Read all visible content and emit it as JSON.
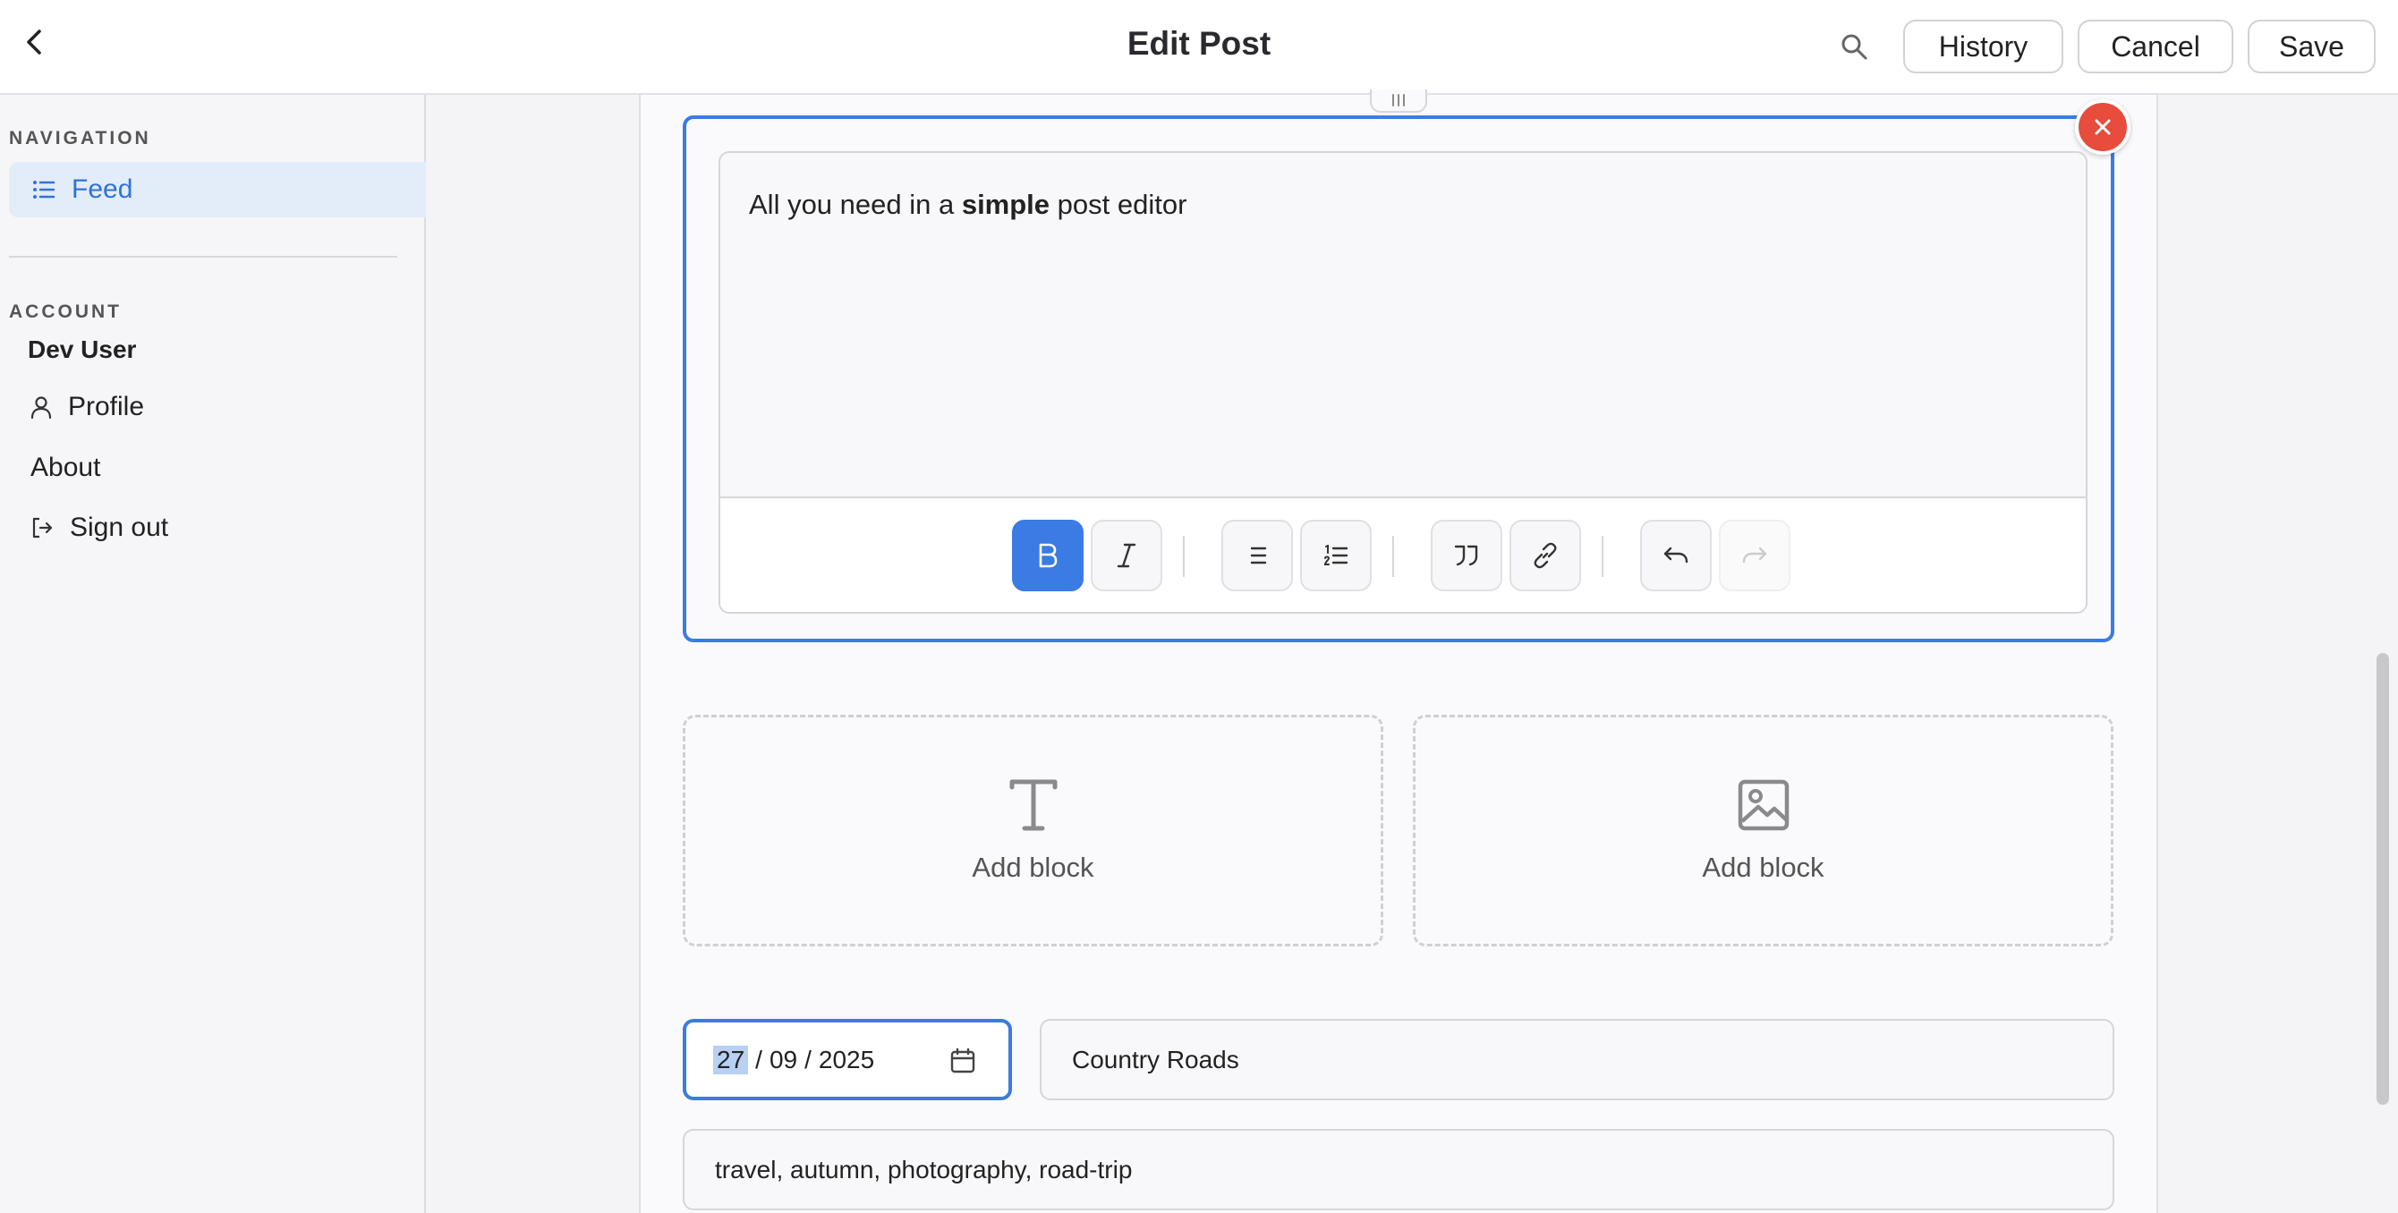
{
  "header": {
    "title": "Edit Post",
    "history_label": "History",
    "cancel_label": "Cancel",
    "save_label": "Save"
  },
  "sidebar": {
    "navigation_label": "NAVIGATION",
    "feed_label": "Feed",
    "account_label": "ACCOUNT",
    "user_name": "Dev User",
    "profile_label": "Profile",
    "about_label": "About",
    "signout_label": "Sign out"
  },
  "editor": {
    "text_before": "All you need in a ",
    "text_bold": "simple",
    "text_after": " post editor",
    "toolbar": [
      "bold",
      "italic",
      "bullet-list",
      "ordered-list",
      "blockquote",
      "link",
      "undo",
      "redo"
    ]
  },
  "add_blocks": [
    {
      "label": "Add block",
      "icon": "text-icon"
    },
    {
      "label": "Add block",
      "icon": "image-icon"
    }
  ],
  "form": {
    "date_day": "27",
    "date_month": "09",
    "date_year": "2025",
    "date_sep": "/",
    "location": "Country Roads",
    "tags": "travel, autumn, photography, road-trip"
  },
  "colors": {
    "accent": "#3b7be4",
    "danger": "#e74c3c",
    "feed_active_bg": "#e3ecf9"
  }
}
